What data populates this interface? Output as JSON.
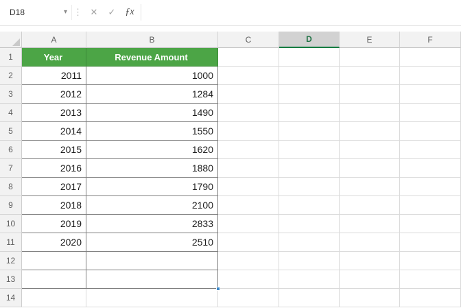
{
  "toolbar": {
    "name_box": "D18",
    "dropdown_icon": "▾",
    "drag_dots_icon": "⋮",
    "cancel_icon": "✕",
    "enter_icon": "✓",
    "fx_icon": "ƒx",
    "formula_bar_value": "",
    "formula_bar_placeholder": ""
  },
  "grid": {
    "columns": [
      "A",
      "B",
      "C",
      "D",
      "E",
      "F"
    ],
    "selected_column": "D",
    "row_count": 14,
    "visible_rows": [
      "1",
      "2",
      "3",
      "4",
      "5",
      "6",
      "7",
      "8",
      "9",
      "10",
      "11",
      "12",
      "13",
      "14"
    ]
  },
  "table": {
    "headers": [
      "Year",
      "Revenue Amount"
    ],
    "rows": [
      [
        "2011",
        "1000"
      ],
      [
        "2012",
        "1284"
      ],
      [
        "2013",
        "1490"
      ],
      [
        "2014",
        "1550"
      ],
      [
        "2015",
        "1620"
      ],
      [
        "2016",
        "1880"
      ],
      [
        "2017",
        "1790"
      ],
      [
        "2018",
        "2100"
      ],
      [
        "2019",
        "2833"
      ],
      [
        "2020",
        "2510"
      ]
    ],
    "bordered_empty_row_count": 2
  },
  "colors": {
    "table_header_green": "#4ca546",
    "selected_header_green": "#107c41",
    "selected_header_text": "#217346",
    "gridline": "#dadada",
    "table_border": "#7d7d7d",
    "header_bg": "#f2f2f2",
    "selected_header_bg": "#d2d2d2",
    "fill_handle_blue": "#3a87c8"
  }
}
